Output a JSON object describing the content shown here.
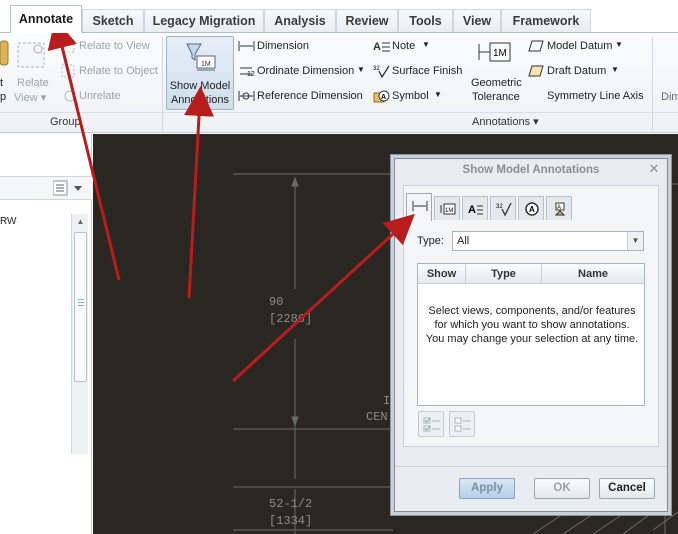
{
  "tabs": [
    {
      "label": "Annotate",
      "active": true
    },
    {
      "label": "Sketch"
    },
    {
      "label": "Legacy Migration"
    },
    {
      "label": "Analysis"
    },
    {
      "label": "Review"
    },
    {
      "label": "Tools"
    },
    {
      "label": "View"
    },
    {
      "label": "Framework"
    }
  ],
  "ribbon": {
    "left_partial": {
      "line1": "t",
      "line2": "p"
    },
    "relate_view": {
      "line1": "Relate",
      "line2": "View ▾"
    },
    "relate_to_view": "Relate to View",
    "relate_to_object": "Relate to Object",
    "unrelate": "Unrelate",
    "group_label": "Group",
    "show_model_annotations": {
      "line1": "Show Model",
      "line2": "Annotations"
    },
    "dimension": "Dimension",
    "ordinate_dimension": "Ordinate Dimension",
    "reference_dimension": "Reference Dimension",
    "note": "Note",
    "surface_finish": "Surface Finish",
    "symbol": "Symbol",
    "geometric_tolerance": {
      "line1": "Geometric",
      "line2": "Tolerance"
    },
    "model_datum": "Model Datum",
    "draft_datum": "Draft Datum",
    "symmetry_line_axis": "Symmetry Line Axis",
    "right_partial": "Dim",
    "annotations_label": "Annotations ▾"
  },
  "left_panel": {
    "tree_item": "RW"
  },
  "drawing": {
    "dim1": "90",
    "dim1_mm": "[2286]",
    "dim2": "52-1/2",
    "dim2_mm": "[1334]",
    "partial_text1": "I",
    "partial_text2": "CEN"
  },
  "dialog": {
    "title": "Show Model Annotations",
    "type_label": "Type:",
    "type_value": "All",
    "columns": [
      "Show",
      "Type",
      "Name"
    ],
    "message_line1": "Select views, components, and/or features",
    "message_line2": "for which you want to show annotations.",
    "message_line3": "You may change your selection at any time.",
    "apply": "Apply",
    "ok": "OK",
    "cancel": "Cancel"
  },
  "colors": {
    "arrow": "#b81c1c",
    "graphics_bg": "#2a2723"
  }
}
